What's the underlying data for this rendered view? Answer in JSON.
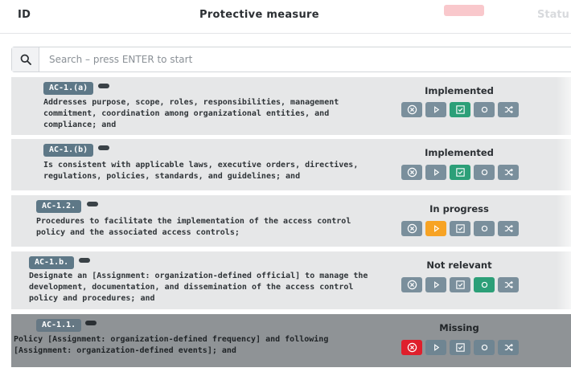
{
  "header": {
    "id_label": "ID",
    "measure_label": "Protective measure",
    "status_label": "Statu"
  },
  "search": {
    "placeholder": "Search – press ENTER to start"
  },
  "colors": {
    "tag": "#5e7887",
    "button": "#7a8f9c",
    "green": "#2c9f78",
    "orange": "#f7a324",
    "red": "#df1f2c"
  },
  "rows": [
    {
      "tag": "AC-1.(a)",
      "status": "Implemented",
      "active": "implemented",
      "text": [
        "Addresses purpose, scope, roles, responsibilities, management",
        "commitment, coordination among organizational entities, and",
        "compliance; and"
      ]
    },
    {
      "tag": "AC-1.(b)",
      "status": "Implemented",
      "active": "implemented",
      "text": [
        "Is consistent with applicable laws, executive orders, directives,",
        "regulations, policies, standards, and guidelines; and"
      ]
    },
    {
      "tag": "AC-1.2.",
      "status": "In progress",
      "active": "in-progress",
      "text": [
        "Procedures to facilitate the implementation of the access control",
        "policy and the associated access controls;"
      ]
    },
    {
      "tag": "AC-1.b.",
      "status": "Not relevant",
      "active": "not-relevant",
      "text": [
        "Designate an [Assignment: organization-defined official] to manage the",
        "development, documentation, and dissemination of the access control",
        "policy and procedures; and"
      ]
    },
    {
      "tag": "AC-1.1.",
      "status": "Missing",
      "active": "missing",
      "text": [
        "Policy [Assignment: organization-defined frequency] and following",
        "[Assignment: organization-defined events]; and"
      ]
    }
  ]
}
